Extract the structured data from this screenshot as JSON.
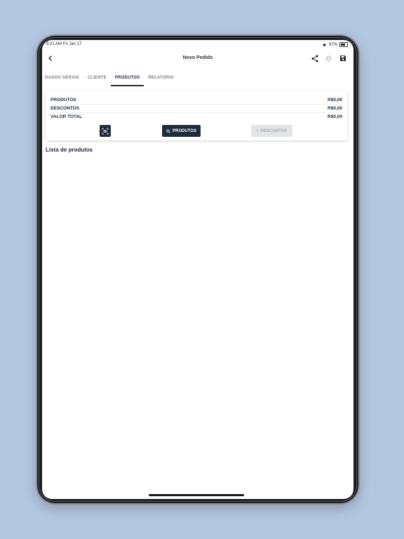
{
  "status_bar": {
    "time": "9:21 AM  Fri Jan 17",
    "battery": "87%"
  },
  "nav": {
    "title": "Novo Pedido",
    "icons": [
      "back-icon",
      "share-icon",
      "cancel-icon",
      "save-icon"
    ]
  },
  "tabs": [
    {
      "label": "DADOS GERAIS",
      "active": false
    },
    {
      "label": "CLIENTE",
      "active": false
    },
    {
      "label": "PRODUTOS",
      "active": true
    },
    {
      "label": "RELATÓRIO",
      "active": false
    }
  ],
  "summary": {
    "rows": [
      {
        "label": "PRODUTOS",
        "value": "R$0,00"
      },
      {
        "label": "DESCONTOS",
        "value": "R$0,00"
      },
      {
        "label": "VALOR TOTAL",
        "value": "R$0,00"
      }
    ],
    "buttons": {
      "barcode_icon": "barcode-scan-icon",
      "produtos_label": "PRODUTOS",
      "descontos_label": "DESCONTOS"
    }
  },
  "list": {
    "title": "Lista de produtos"
  },
  "colors": {
    "primary": "#1f2b3e",
    "background": "#b3c6e0",
    "disabled": "#e3e4e6"
  }
}
